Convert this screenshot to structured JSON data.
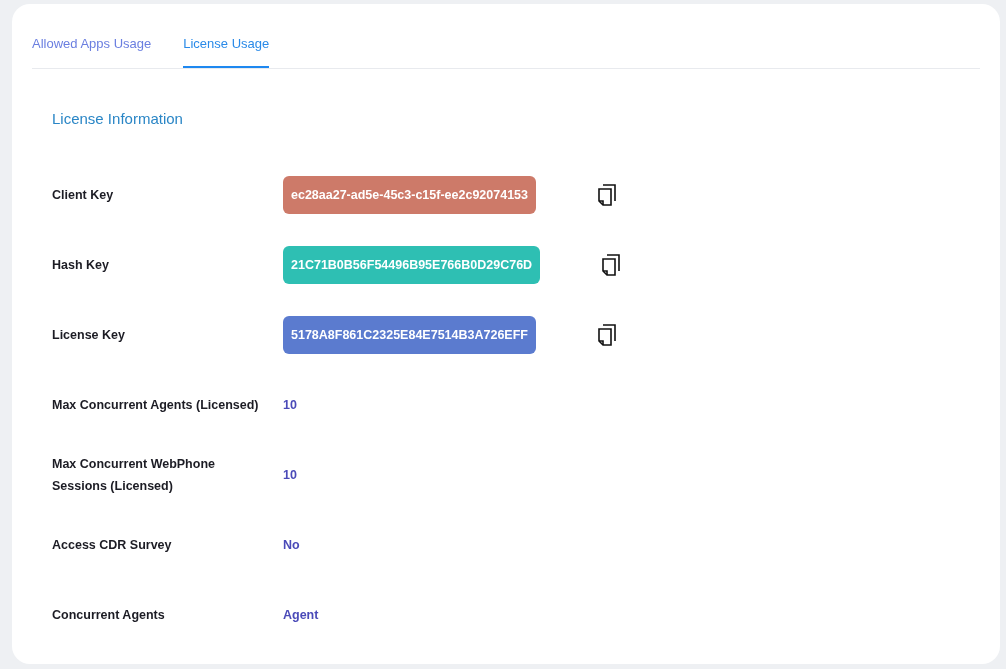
{
  "tabs": [
    {
      "label": "Allowed Apps Usage",
      "selected": false
    },
    {
      "label": "License Usage",
      "selected": true
    }
  ],
  "section_title": "License Information",
  "rows": [
    {
      "kind": "key",
      "label": "Client Key",
      "value": "ec28aa27-ad5e-45c3-c15f-ee2c92074153",
      "color": "#cd7a69"
    },
    {
      "kind": "key",
      "label": "Hash Key",
      "value": "21C71B0B56F54496B95E766B0D29C76D",
      "color": "#2ebfb3"
    },
    {
      "kind": "key",
      "label": "License Key",
      "value": "5178A8F861C2325E84E7514B3A726EFF",
      "color": "#5b7bcf"
    },
    {
      "kind": "text",
      "label": "Max Concurrent Agents (Licensed)",
      "value": "10"
    },
    {
      "kind": "text",
      "label": "Max Concurrent WebPhone Sessions (Licensed)",
      "value": "10"
    },
    {
      "kind": "text",
      "label": "Access CDR Survey",
      "value": "No"
    },
    {
      "kind": "text",
      "label": "Concurrent Agents",
      "value": "Agent"
    }
  ]
}
